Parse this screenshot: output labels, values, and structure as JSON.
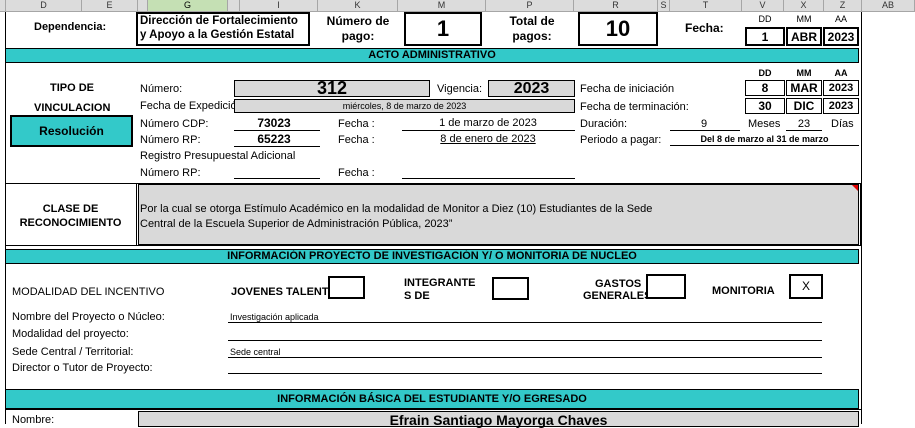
{
  "columns": [
    "D",
    "E",
    "G",
    "I",
    "K",
    "M",
    "P",
    "R",
    "S",
    "T",
    "V",
    "X",
    "Z",
    "AB"
  ],
  "header": {
    "dependencia_label": "Dependencia:",
    "dependencia_value_line1": "Dirección de Fortalecimiento",
    "dependencia_value_line2": "y Apoyo a la Gestión Estatal",
    "numero_pago_label_line1": "Número de",
    "numero_pago_label_line2": "pago:",
    "numero_pago_value": "1",
    "total_pagos_label_line1": "Total de",
    "total_pagos_label_line2": "pagos:",
    "total_pagos_value": "10",
    "fecha_label": "Fecha:",
    "dd_label": "DD",
    "mm_label": "MM",
    "aa_label": "AA",
    "fecha_dd": "1",
    "fecha_mm": "ABR",
    "fecha_aa": "2023"
  },
  "acto": {
    "title": "ACTO ADMINISTRATIVO",
    "tipo_label_line1": "TIPO DE",
    "tipo_label_line2": "VINCULACION",
    "tipo_value": "Resolución",
    "numero_label": "Número:",
    "numero_value": "312",
    "vigencia_label": "Vigencia:",
    "vigencia_value": "2023",
    "fecha_expedicion_label": "Fecha de Expedición",
    "fecha_expedicion_value": "miércoles, 8 de marzo de 2023",
    "numero_cdp_label": "Número CDP:",
    "numero_cdp_value": "73023",
    "fecha1_label": "Fecha :",
    "fecha_cdp_value": "1 de marzo de 2023",
    "numero_rp_label": "Número RP:",
    "numero_rp_value": "65223",
    "fecha2_label": "Fecha :",
    "fecha_rp_value": "8 de enero de 2023",
    "registro_label": "Registro Presupuestal Adicional",
    "numero_rp2_label": "Número RP:",
    "fecha3_label": "Fecha :",
    "fecha_inicio_label": "Fecha de iniciación",
    "fecha_fin_label": "Fecha de terminación:",
    "duracion_label": "Duración:",
    "periodo_label": "Periodo a pagar:",
    "dd_label": "DD",
    "mm_label": "MM",
    "aa_label": "AA",
    "inicio_dd": "8",
    "inicio_mm": "MAR",
    "inicio_aa": "2023",
    "fin_dd": "30",
    "fin_mm": "DIC",
    "fin_aa": "2023",
    "duracion_meses_value": "9",
    "meses_label": "Meses",
    "duracion_dias_value": "23",
    "dias_label": "Días",
    "periodo_value": "Del 8 de marzo al 31 de marzo"
  },
  "clase": {
    "label_line1": "CLASE DE",
    "label_line2": "RECONOCIMIENTO",
    "text_line1": "Por la cual se otorga Estímulo Académico en la modalidad de Monitor a Diez (10) Estudiantes de la Sede",
    "text_line2": "Central de la Escuela Superior de Administración Pública, 2023”"
  },
  "proyecto": {
    "title": "INFORMACIÓN PROYECTO DE INVESTIGACIÓN Y/ O MONITORIA DE NUCLEO",
    "modalidad_label": "MODALIDAD DEL INCENTIVO",
    "jovenes_label": "JOVENES TALENTO",
    "integrantes_label_line1": "INTEGRANTE",
    "integrantes_label_line2": "S DE",
    "gastos_label_line1": "GASTOS",
    "gastos_label_line2": "GENERALES",
    "monitoria_label": "MONITORIA",
    "monitoria_mark": "X",
    "nombre_label": "Nombre del Proyecto o Núcleo:",
    "nombre_value": "Investigación aplicada",
    "modalidad_proyecto_label": "Modalidad del proyecto:",
    "sede_label": "Sede Central / Territorial:",
    "sede_value": "Sede central",
    "director_label": "Director o Tutor de Proyecto:"
  },
  "estudiante": {
    "title": "INFORMACIÓN BÁSICA DEL ESTUDIANTE Y/O EGRESADO",
    "nombre_label": "Nombre:",
    "nombre_value": "Efrain Santiago Mayorga Chaves"
  }
}
